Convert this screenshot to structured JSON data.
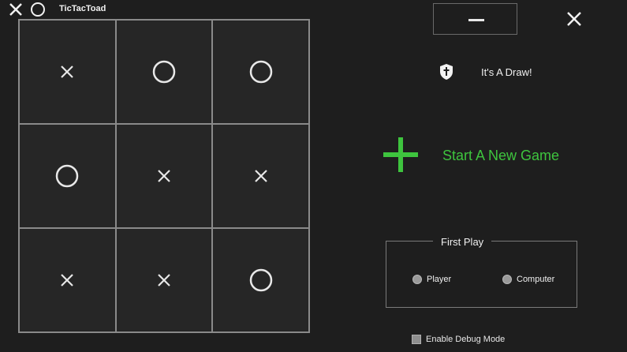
{
  "window": {
    "title": "TicTacToad",
    "logo_icons": [
      "x-icon",
      "o-icon"
    ]
  },
  "board": {
    "cells": [
      "X",
      "O",
      "O",
      "O",
      "X",
      "X",
      "X",
      "X",
      "O"
    ]
  },
  "status": {
    "icon": "shield-icon",
    "text": "It's A Draw!"
  },
  "new_game": {
    "label": "Start A New Game",
    "icon": "plus-icon"
  },
  "first_play": {
    "legend": "First Play",
    "options": [
      "Player",
      "Computer"
    ]
  },
  "debug": {
    "label": "Enable Debug Mode"
  },
  "colors": {
    "background": "#1e1e1e",
    "cell": "#262626",
    "accent": "#3ec43e"
  }
}
